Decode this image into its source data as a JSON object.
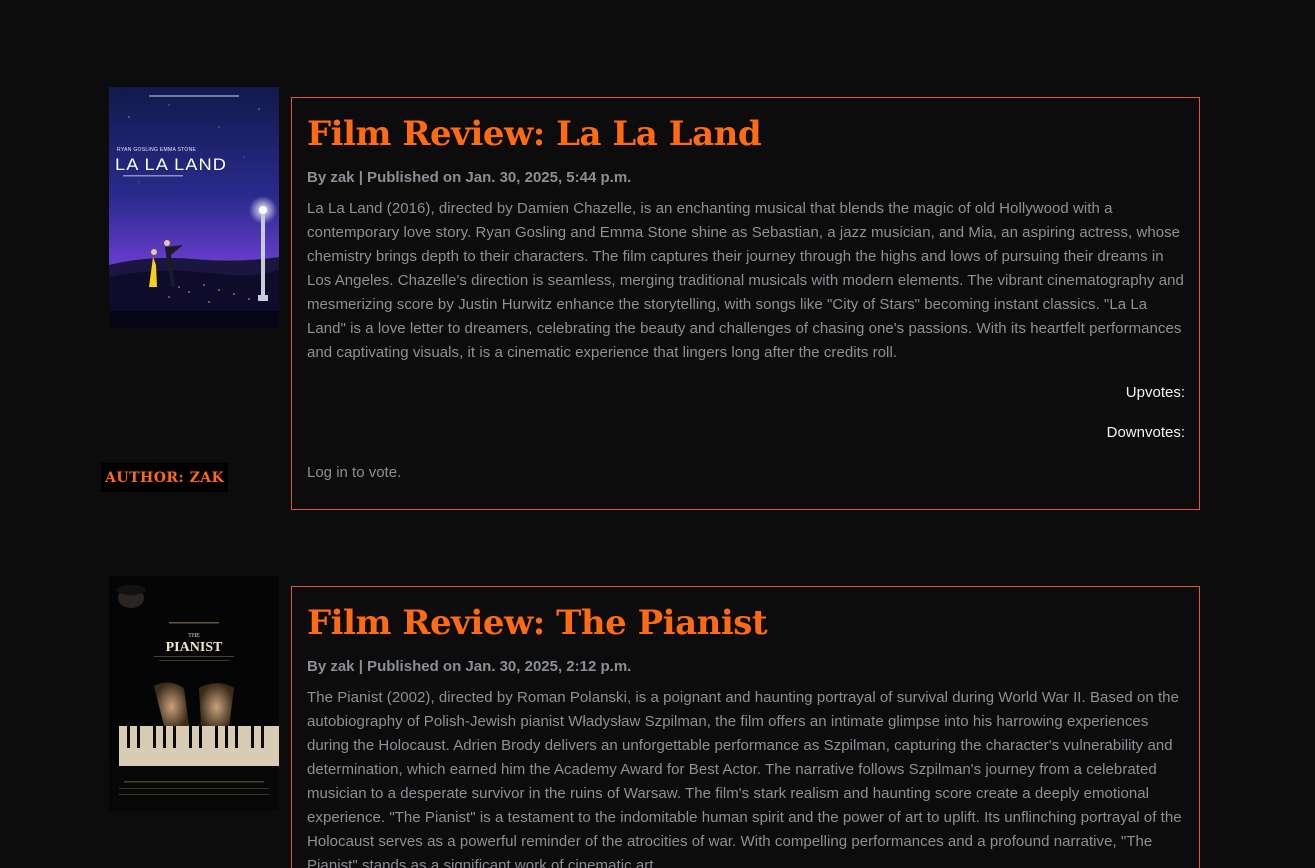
{
  "posts": [
    {
      "title": "Film Review: La La Land",
      "byline": "By zak | Published on Jan. 30, 2025, 5:44 p.m.",
      "body": "La La Land (2016), directed by Damien Chazelle, is an enchanting musical that blends the magic of old Hollywood with a contemporary love story. Ryan Gosling and Emma Stone shine as Sebastian, a jazz musician, and Mia, an aspiring actress, whose chemistry brings depth to their characters. The film captures their journey through the highs and lows of pursuing their dreams in Los Angeles. Chazelle's direction is seamless, merging traditional musicals with modern elements. The vibrant cinematography and mesmerizing score by Justin Hurwitz enhance the storytelling, with songs like \"City of Stars\" becoming instant classics. \"La La Land\" is a love letter to dreamers, celebrating the beauty and challenges of chasing one's passions. With its heartfelt performances and captivating visuals, it is a cinematic experience that lingers long after the credits roll.",
      "upvotes_label": "Upvotes:",
      "downvotes_label": "Downvotes:",
      "login_text": "Log in to vote.",
      "author_tag": "Author: zak",
      "poster": {
        "actors": "RYAN GOSLING    EMMA STONE",
        "title": "LA LA LAND"
      }
    },
    {
      "title": "Film Review: The Pianist",
      "byline": "By zak | Published on Jan. 30, 2025, 2:12 p.m.",
      "body": "The Pianist (2002), directed by Roman Polanski, is a poignant and haunting portrayal of survival during World War II. Based on the autobiography of Polish-Jewish pianist Władysław Szpilman, the film offers an intimate glimpse into his harrowing experiences during the Holocaust. Adrien Brody delivers an unforgettable performance as Szpilman, capturing the character's vulnerability and determination, which earned him the Academy Award for Best Actor. The narrative follows Szpilman's journey from a celebrated musician to a desperate survivor in the ruins of Warsaw. The film's stark realism and haunting score create a deeply emotional experience. \"The Pianist\" is a testament to the indomitable human spirit and the power of art to uplift. Its unflinching portrayal of the Holocaust serves as a powerful reminder of the atrocities of war. With compelling performances and a profound narrative, \"The Pianist\" stands as a significant work of cinematic art.",
      "poster": {
        "title_small": "THE",
        "title": "PIANIST"
      }
    }
  ],
  "colors": {
    "background": "#0c0c0c",
    "accent": "#ff6a12",
    "card_border": "#e2543c",
    "muted_text": "#8d9096",
    "vote_text": "#f2f2f2"
  }
}
